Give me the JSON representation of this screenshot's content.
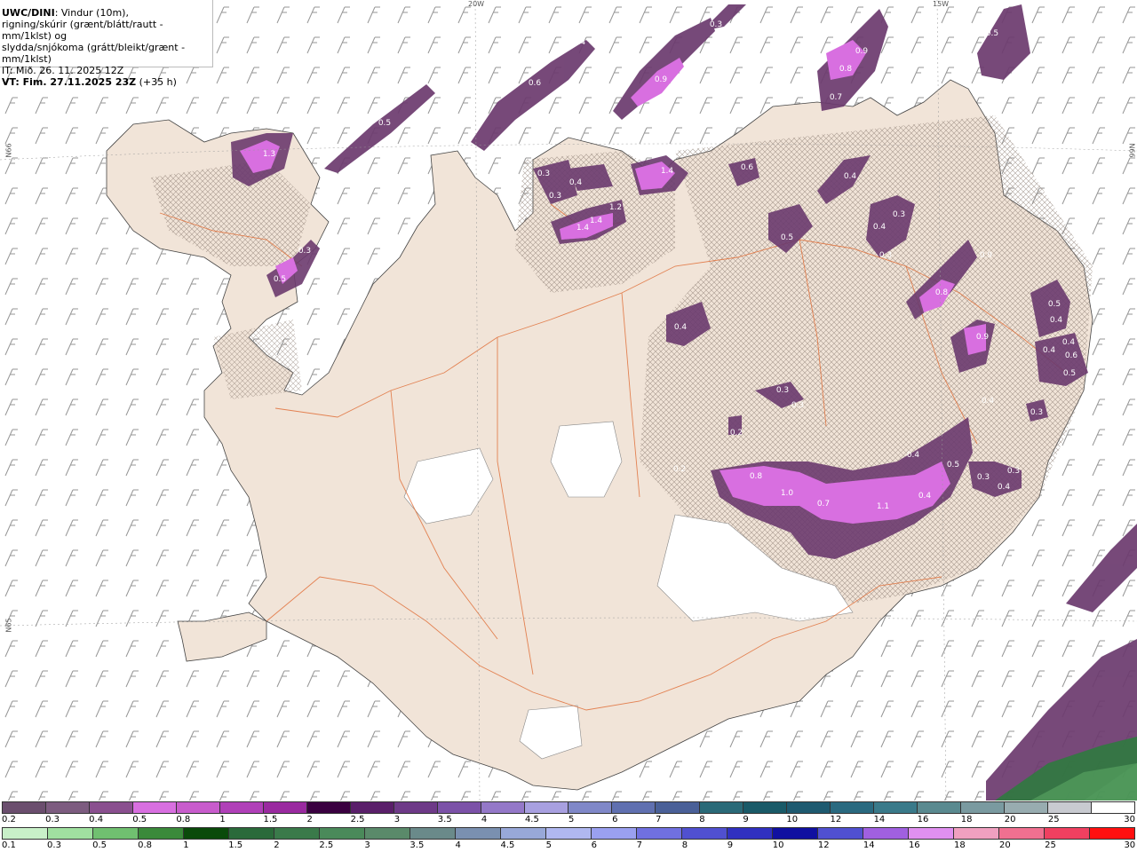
{
  "header": {
    "model": "UWC/DINI",
    "title_rest": ": Vindur (10m),",
    "line2": "rigning/skúrir (grænt/blátt/rautt - mm/1klst) og",
    "line3": "slydda/snjókoma (grátt/bleikt/grænt - mm/1klst)",
    "line4": "IT: Mið. 26. 11. 2025 12Z",
    "line5": "VT: Fim. 27.11.2025 23Z",
    "line5_suffix": " (+35 h)"
  },
  "grid_labels": {
    "w20": "20W",
    "w15": "15W",
    "n66_left": "N66",
    "n66_right": "N66",
    "n65": "N65"
  },
  "precip_labels": [
    "0.4",
    "0.6",
    "0.5",
    "1.3",
    "0.3",
    "0.5",
    "0.3",
    "0.4",
    "0.3",
    "1.4",
    "1.4",
    "1.2",
    "1.4",
    "0.9",
    "0.3",
    "0.5",
    "0.9",
    "0.8",
    "0.7",
    "0.6",
    "0.4",
    "0.4",
    "0.3",
    "0.3",
    "0.5",
    "0.4",
    "0.9",
    "0.8",
    "0.9",
    "0.5",
    "0.4",
    "0.4",
    "0.4",
    "0.6",
    "0.5",
    "0.3",
    "0.3",
    "0.3",
    "0.4",
    "0.5",
    "0.4",
    "0.3",
    "0.3",
    "0.4",
    "0.8",
    "1.0",
    "0.7",
    "1.1",
    "0.4",
    "0.2",
    "0.2",
    "0.2"
  ],
  "legend_top": {
    "label": "slydda/snjókoma",
    "values": [
      "0.2",
      "0.3",
      "0.4",
      "0.5",
      "0.8",
      "1",
      "1.5",
      "2",
      "2.5",
      "3",
      "3.5",
      "4",
      "4.5",
      "5",
      "6",
      "7",
      "8",
      "9",
      "10",
      "12",
      "14",
      "16",
      "18",
      "20",
      "25",
      "30"
    ],
    "colors": [
      "#6b4e6e",
      "#7d5c80",
      "#8a4f8f",
      "#d86fe0",
      "#c85ccc",
      "#b040b8",
      "#9a2aa0",
      "#3a0040",
      "#5a1f6a",
      "#6e3a88",
      "#7c52a8",
      "#9478c8",
      "#a8a0e0",
      "#8088c8",
      "#6070b0",
      "#4a6098",
      "#2a6a78",
      "#1a5a68",
      "#1e5a70",
      "#2a6a80",
      "#3a7a8a",
      "#5a8a90",
      "#7a9aa0",
      "#98acb0",
      "#c8cad0",
      "#ffffff"
    ]
  },
  "legend_bottom": {
    "label": "rigning/skúrir",
    "values": [
      "0.1",
      "0.3",
      "0.5",
      "0.8",
      "1",
      "1.5",
      "2",
      "2.5",
      "3",
      "3.5",
      "4",
      "4.5",
      "5",
      "6",
      "7",
      "8",
      "9",
      "10",
      "12",
      "14",
      "16",
      "18",
      "20",
      "25",
      "30"
    ],
    "colors": [
      "#c8f0c8",
      "#a0e0a0",
      "#70c070",
      "#3a8a3a",
      "#0a4a0a",
      "#2a6a3a",
      "#3a7a4a",
      "#4a8a5a",
      "#5a8a6a",
      "#6a8a8a",
      "#7a90b0",
      "#98a8d8",
      "#b0b8f0",
      "#9aa0f0",
      "#7070e0",
      "#5050d0",
      "#3030c0",
      "#1010a0",
      "#5050d0",
      "#a060e0",
      "#e090f0",
      "#f0a0c0",
      "#f07090",
      "#f04060",
      "#ff1010"
    ]
  }
}
